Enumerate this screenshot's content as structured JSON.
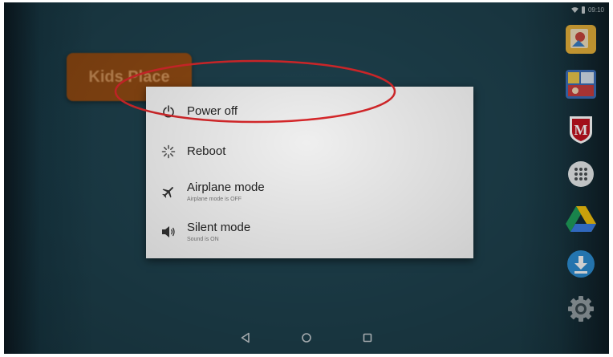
{
  "status_bar": {
    "time": "09:10",
    "icons": [
      "wifi-icon",
      "battery-icon"
    ]
  },
  "launcher": {
    "app_label": "Kids Place"
  },
  "dock": {
    "apps": [
      "photo-app-icon",
      "album-app-icon",
      "mcafee-icon",
      "app-drawer-icon",
      "google-drive-icon",
      "download-icon",
      "settings-icon"
    ]
  },
  "power_menu": {
    "items": [
      {
        "label": "Power off",
        "icon": "power-icon",
        "subtitle": ""
      },
      {
        "label": "Reboot",
        "icon": "reboot-icon",
        "subtitle": ""
      },
      {
        "label": "Airplane mode",
        "icon": "airplane-icon",
        "subtitle": "Airplane mode is OFF"
      },
      {
        "label": "Silent mode",
        "icon": "volume-icon",
        "subtitle": "Sound is ON"
      }
    ]
  },
  "annotation": {
    "color": "#d8282b"
  },
  "nav_bar": {
    "buttons": [
      "back-icon",
      "home-icon",
      "recents-icon"
    ]
  },
  "colors": {
    "background": "#1d3f4b",
    "dialog": "#efefef",
    "kids_place": "#8a4712"
  }
}
